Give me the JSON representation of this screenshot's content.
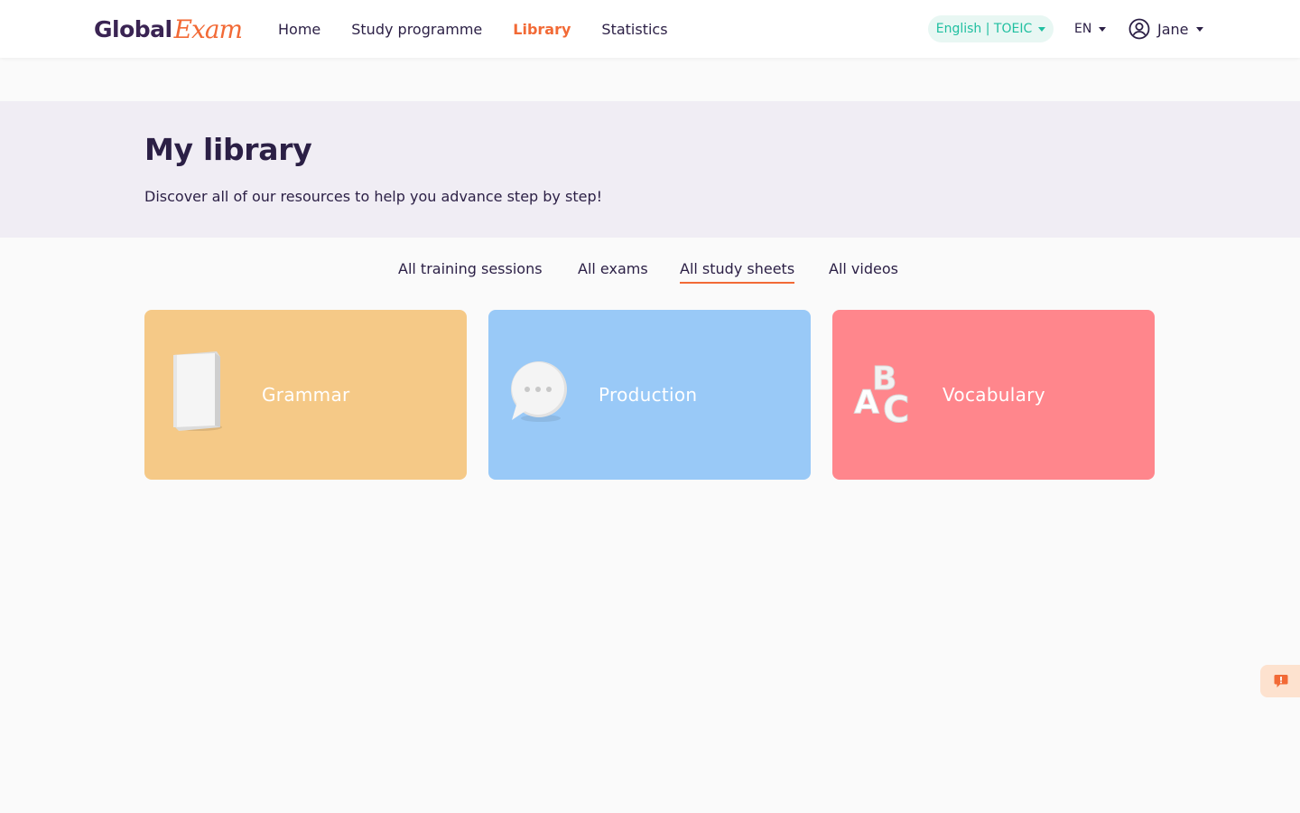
{
  "brand": {
    "part1": "Global",
    "part2": "Exam"
  },
  "nav": {
    "items": [
      {
        "label": "Home",
        "active": false
      },
      {
        "label": "Study programme",
        "active": false
      },
      {
        "label": "Library",
        "active": true
      },
      {
        "label": "Statistics",
        "active": false
      }
    ]
  },
  "header": {
    "course": "English | TOEIC",
    "language": "EN",
    "user": "Jane"
  },
  "hero": {
    "title": "My library",
    "subtitle": "Discover all of our resources to help you advance step by step!"
  },
  "tabs": [
    {
      "label": "All training sessions",
      "active": false
    },
    {
      "label": "All exams",
      "active": false
    },
    {
      "label": "All study sheets",
      "active": true
    },
    {
      "label": "All videos",
      "active": false
    }
  ],
  "cards": [
    {
      "label": "Grammar",
      "color": "#f5c987",
      "icon": "book-icon"
    },
    {
      "label": "Production",
      "color": "#99c9f7",
      "icon": "speech-bubble-icon"
    },
    {
      "label": "Vocabulary",
      "color": "#ff868c",
      "icon": "abc-letters-icon"
    }
  ],
  "colors": {
    "accent": "#f26a36",
    "brand": "#3a2453",
    "course": "#1fbfa0"
  }
}
